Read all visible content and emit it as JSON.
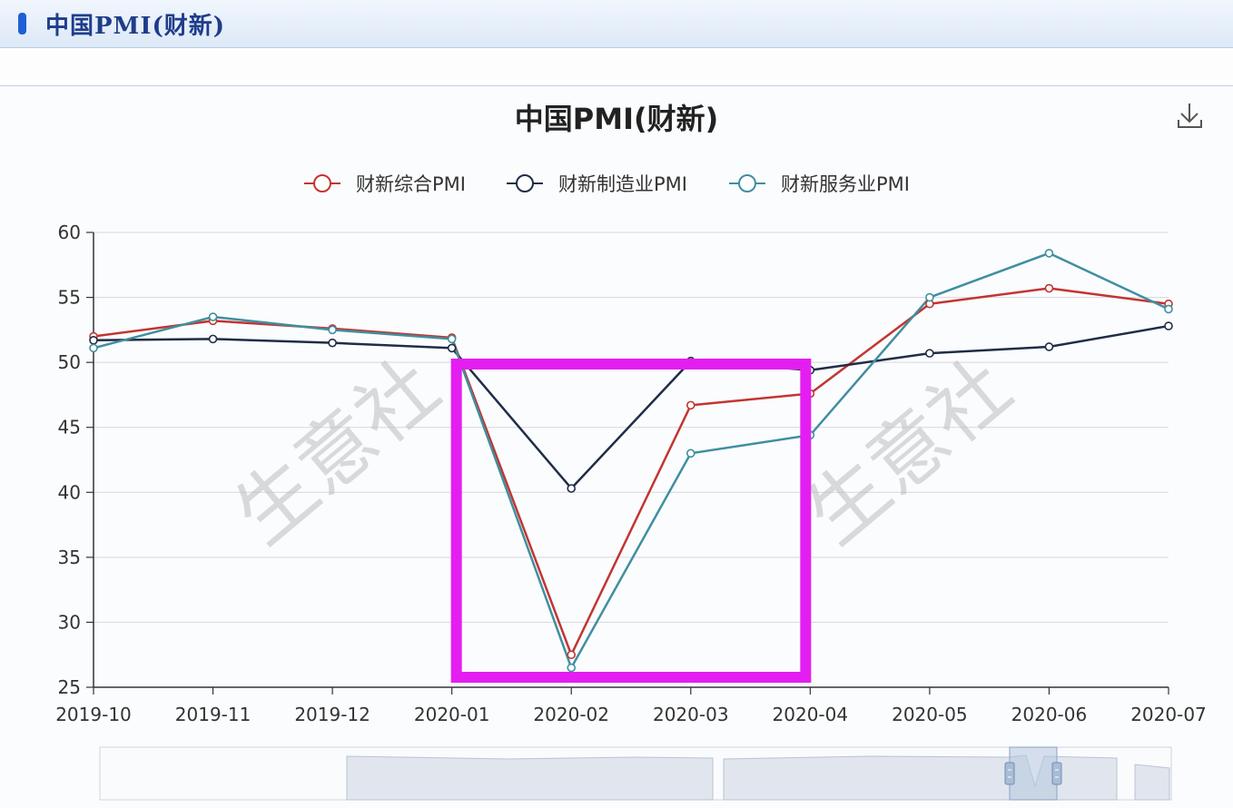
{
  "panel": {
    "title": "中国PMI(财新)"
  },
  "watermark": "生意社",
  "chart_data": {
    "type": "line",
    "title": "中国PMI(财新)",
    "xlabel": "",
    "ylabel": "",
    "ylim": [
      25,
      60
    ],
    "yticks": [
      25,
      30,
      35,
      40,
      45,
      50,
      55,
      60
    ],
    "grid": true,
    "legend_position": "top-center",
    "categories": [
      "2019-10",
      "2019-11",
      "2019-12",
      "2020-01",
      "2020-02",
      "2020-03",
      "2020-04",
      "2020-05",
      "2020-06",
      "2020-07"
    ],
    "series": [
      {
        "name": "财新综合PMI",
        "color": "#c23531",
        "values": [
          52.0,
          53.2,
          52.6,
          51.9,
          27.5,
          46.7,
          47.6,
          54.5,
          55.7,
          54.5
        ]
      },
      {
        "name": "财新制造业PMI",
        "color": "#1f2d46",
        "values": [
          51.7,
          51.8,
          51.5,
          51.1,
          40.3,
          50.1,
          49.4,
          50.7,
          51.2,
          52.8
        ]
      },
      {
        "name": "财新服务业PMI",
        "color": "#3f8fa0",
        "values": [
          51.1,
          53.5,
          52.5,
          51.8,
          26.5,
          43.0,
          44.4,
          55.0,
          58.4,
          54.1
        ]
      }
    ],
    "highlight_range": [
      "2020-01",
      "2020-04"
    ],
    "highlight_color": "#e41ef0"
  },
  "icons": {
    "download": "download-icon",
    "panel_marker": "title-marker-icon"
  }
}
